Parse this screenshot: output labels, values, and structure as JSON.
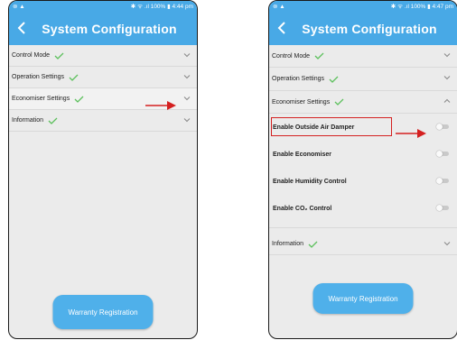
{
  "colors": {
    "accent": "#48a9e6",
    "check": "#5cc05c",
    "highlight": "#d42020"
  },
  "left_screen": {
    "status": {
      "left": "⊚ ▲",
      "right": "✱ ᯤ .ıl 100% ▮ 4:44 pm"
    },
    "title": "System Configuration",
    "rows": [
      {
        "label": "Control Mode"
      },
      {
        "label": "Operation Settings"
      },
      {
        "label": "Economiser Settings"
      },
      {
        "label": "Information"
      }
    ],
    "warranty_label": "Warranty Registration"
  },
  "right_screen": {
    "status": {
      "left": "⊚ ▲",
      "right": "✱ ᯤ .ıl 100% ▮ 4:47 pm"
    },
    "title": "System Configuration",
    "rows": [
      {
        "label": "Control Mode"
      },
      {
        "label": "Operation Settings"
      },
      {
        "label": "Economiser Settings",
        "expanded": true
      },
      {
        "label": "Information"
      }
    ],
    "economiser_options": [
      {
        "label": "Enable Outside Air Damper",
        "enabled": false
      },
      {
        "label": "Enable Economiser",
        "enabled": false
      },
      {
        "label": "Enable Humidity Control",
        "enabled": false
      },
      {
        "label": "Enable CO₂ Control",
        "enabled": false
      }
    ],
    "warranty_label": "Warranty Registration"
  }
}
